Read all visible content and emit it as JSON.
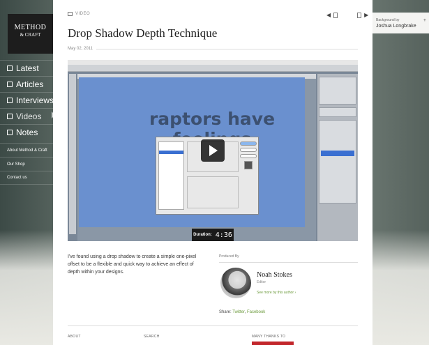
{
  "logo": {
    "line1": "METHOD",
    "line2": "& CRAFT"
  },
  "nav": {
    "items": [
      {
        "label": "Latest"
      },
      {
        "label": "Articles"
      },
      {
        "label": "Interviews"
      },
      {
        "label": "Videos",
        "active": true
      },
      {
        "label": "Notes"
      }
    ]
  },
  "subnav": {
    "items": [
      {
        "label": "About Method & Craft"
      },
      {
        "label": "Our Shop"
      },
      {
        "label": "Contact us"
      }
    ]
  },
  "header": {
    "section": "VIDEO",
    "title": "Drop Shadow Depth Technique",
    "date": "May 02, 2011"
  },
  "video": {
    "canvas_text": "raptors have feelings",
    "duration_label": "Duration:",
    "duration_value": "4:36"
  },
  "article": {
    "description": "I've found using a drop shadow to create a simple one-pixel offset to be a flexible and quick way to achieve an effect of depth within your designs."
  },
  "producer": {
    "heading": "Produced By",
    "name": "Noah Stokes",
    "role": "Editor",
    "more_link": "See more by this author"
  },
  "share": {
    "label": "Share:",
    "twitter": "Twitter",
    "facebook": "Facebook"
  },
  "footer": {
    "about": "ABOUT",
    "search": "SEARCH",
    "thanks": "MANY THANKS TO"
  },
  "credit": {
    "label": "Background by",
    "name": "Joshua Longbrake"
  },
  "colors": {
    "accent_green": "#6c9a3c",
    "footer_red": "#c2262b",
    "canvas_blue": "#6a90cf"
  }
}
